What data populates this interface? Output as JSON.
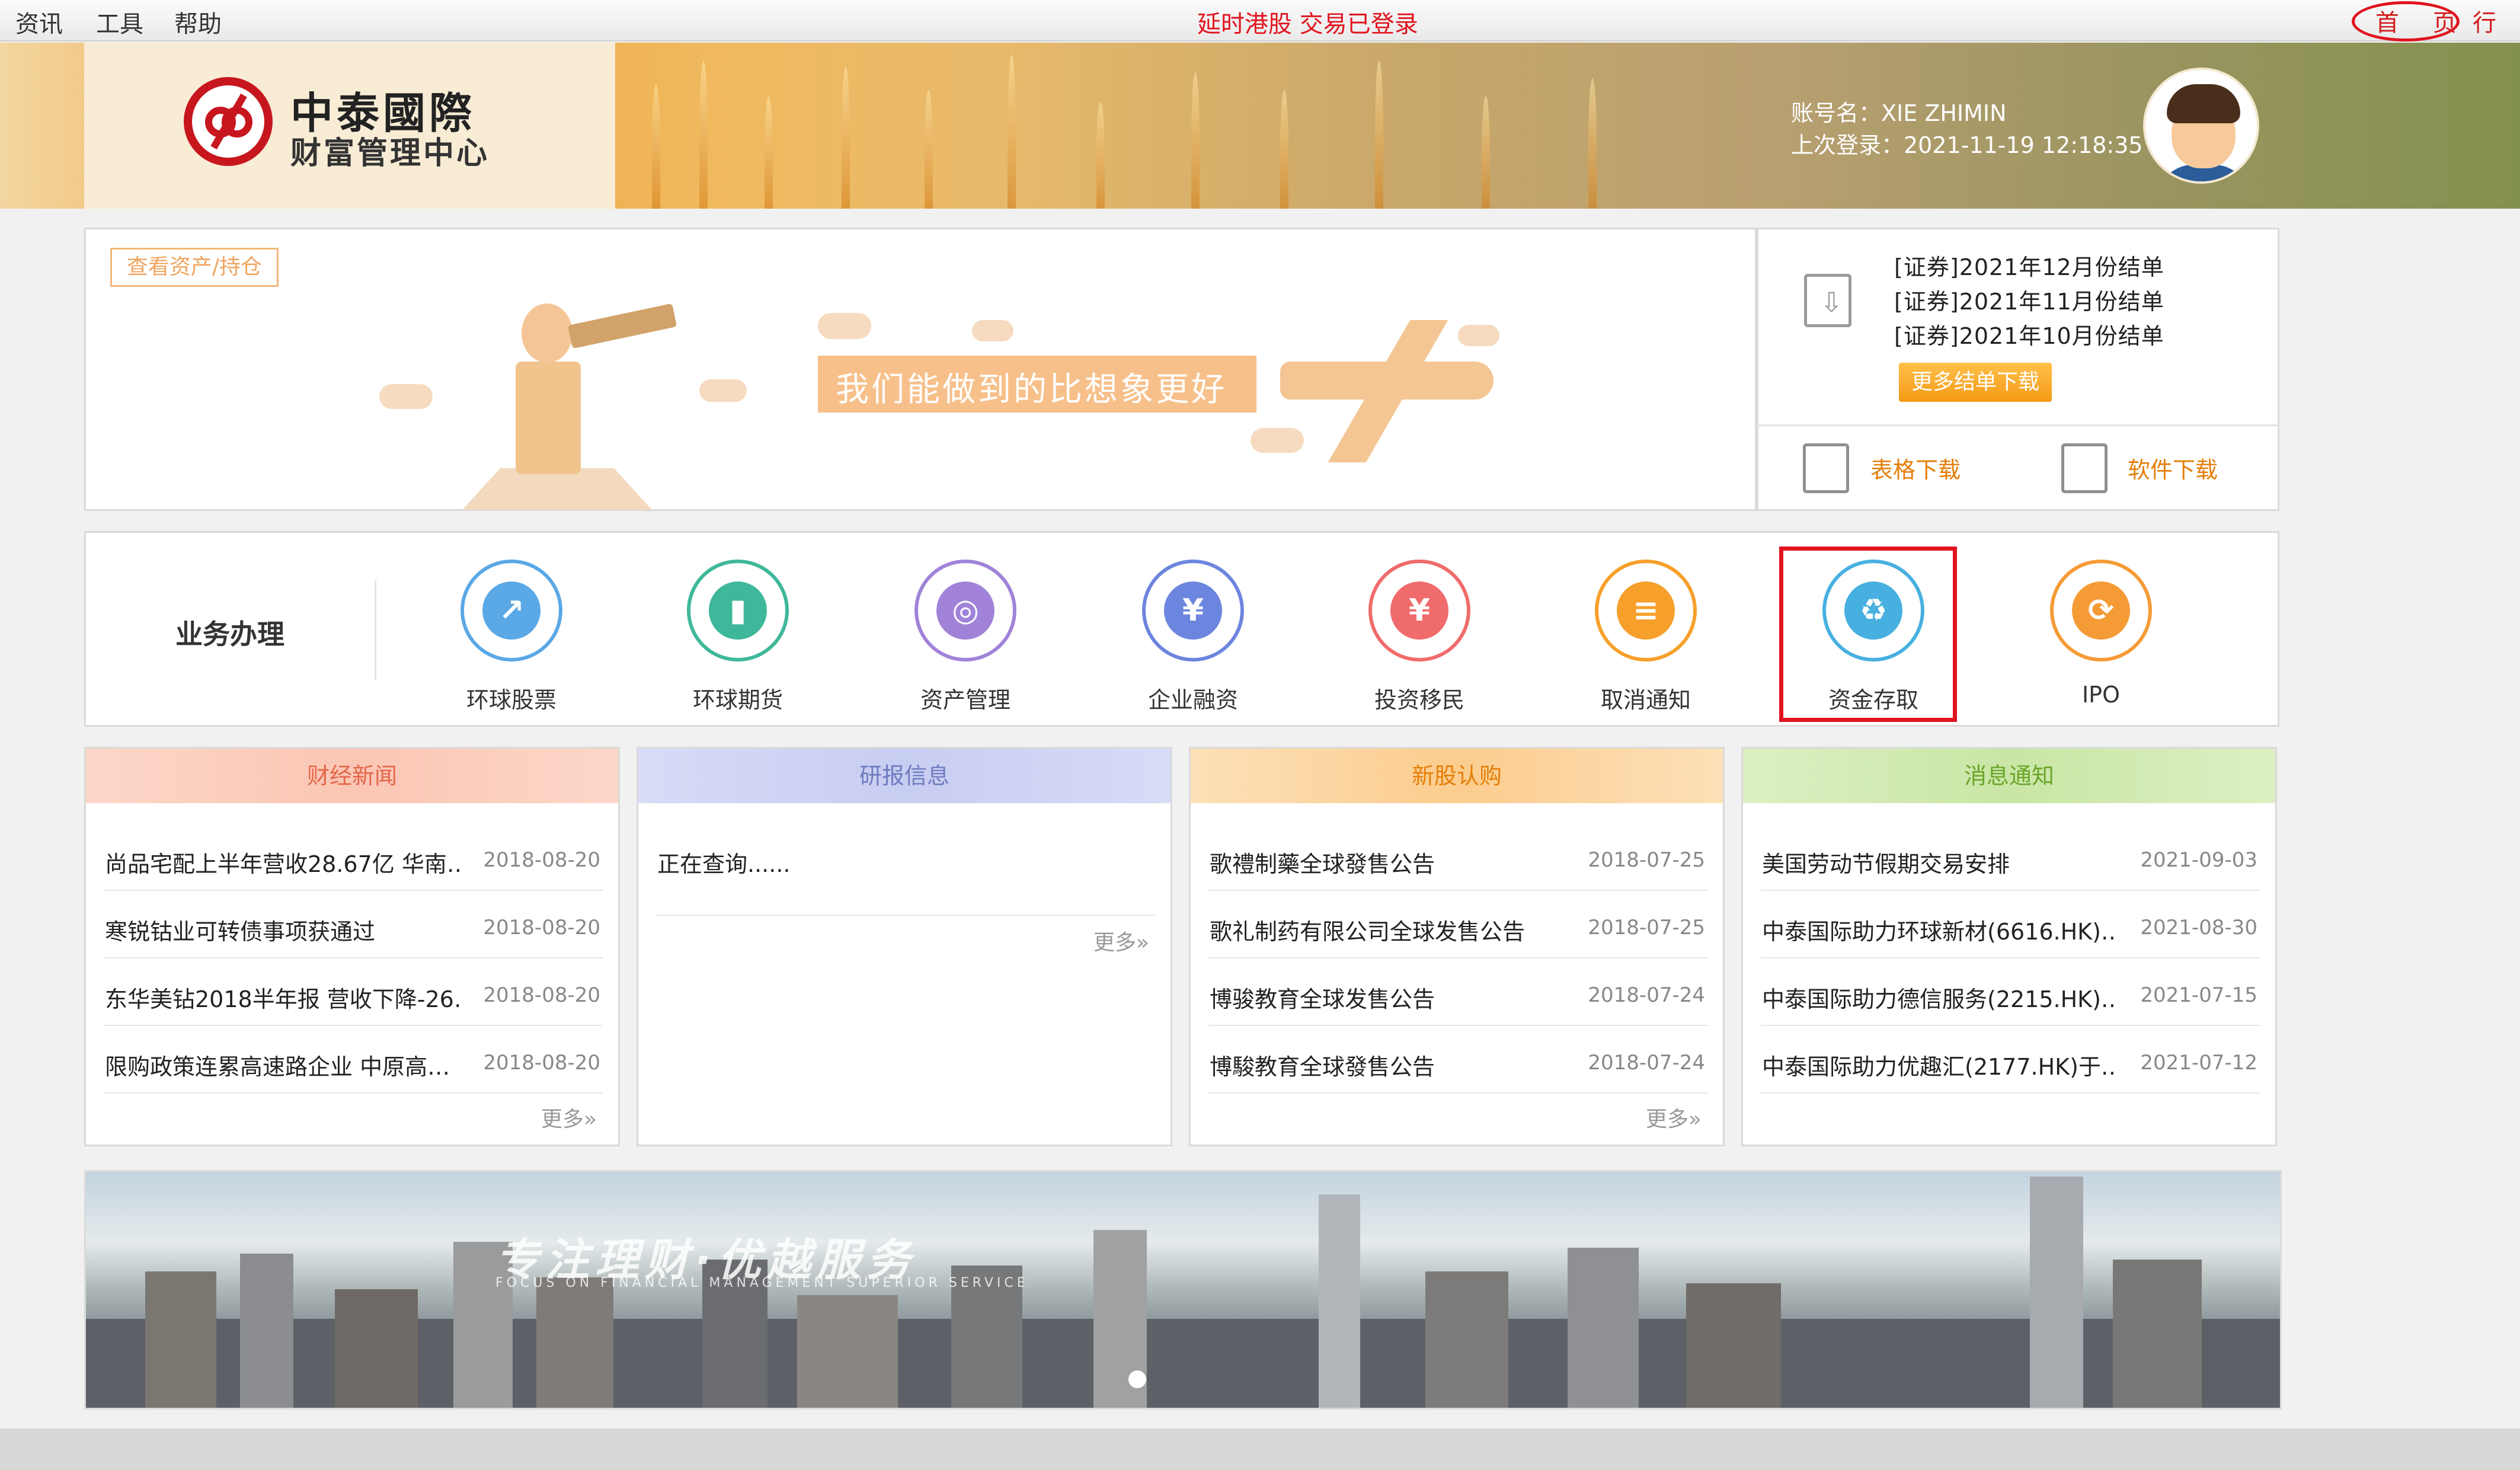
{
  "menubar": {
    "items": [
      "资讯",
      "工具",
      "帮助"
    ],
    "notice": "延时港股 交易已登录",
    "home": "首 页",
    "more": "行"
  },
  "header": {
    "logo_title": "中泰國際",
    "logo_sub": "财富管理中心",
    "account_name": "账号名：XIE ZHIMIN",
    "last_login": "上次登录：2021-11-19 12:18:35"
  },
  "promo": {
    "view_assets": "查看资产/持仓",
    "slogan": "我们能做到的比想象更好"
  },
  "statements": {
    "items": [
      "[证券]2021年12月份结单",
      "[证券]2021年11月份结单",
      "[证券]2021年10月份结单"
    ],
    "more_button": "更多结单下载",
    "form_download": "表格下载",
    "software_download": "软件下载"
  },
  "services": {
    "title": "业务办理",
    "items": [
      {
        "label": "环球股票",
        "icon": "stock-chart-icon",
        "color": "#5aa8e6"
      },
      {
        "label": "环球期货",
        "icon": "bar-chart-icon",
        "color": "#3fb79a"
      },
      {
        "label": "资产管理",
        "icon": "coins-icon",
        "color": "#a083d9"
      },
      {
        "label": "企业融资",
        "icon": "money-bag-icon",
        "color": "#6c85de"
      },
      {
        "label": "投资移民",
        "icon": "hand-money-icon",
        "color": "#f06b6b"
      },
      {
        "label": "取消通知",
        "icon": "document-icon",
        "color": "#f6a02b"
      },
      {
        "label": "资金存取",
        "icon": "globe-recycle-icon",
        "color": "#47b0e0"
      },
      {
        "label": "IPO",
        "icon": "refresh-icon",
        "color": "#f59b36"
      }
    ]
  },
  "cards": {
    "finance_news": {
      "title": "财经新闻",
      "rows": [
        {
          "title": "尚品宅配上半年营收28.67亿 华南…",
          "date": "2018-08-20"
        },
        {
          "title": "寒锐钴业可转债事项获通过",
          "date": "2018-08-20"
        },
        {
          "title": "东华美钻2018半年报 营收下降-26…",
          "date": "2018-08-20"
        },
        {
          "title": "限购政策连累高速路企业 中原高…",
          "date": "2018-08-20"
        }
      ],
      "more": "更多»"
    },
    "research": {
      "title": "研报信息",
      "loading": "正在查询......",
      "more": "更多»"
    },
    "ipo_sub": {
      "title": "新股认购",
      "rows": [
        {
          "title": "歌禮制藥全球發售公告",
          "date": "2018-07-25"
        },
        {
          "title": "歌礼制药有限公司全球发售公告",
          "date": "2018-07-25"
        },
        {
          "title": "博骏教育全球发售公告",
          "date": "2018-07-24"
        },
        {
          "title": "博駿教育全球發售公告",
          "date": "2018-07-24"
        }
      ],
      "more": "更多»"
    },
    "notices": {
      "title": "消息通知",
      "rows": [
        {
          "title": "美国劳动节假期交易安排",
          "date": "2021-09-03"
        },
        {
          "title": "中泰国际助力环球新材(6616.HK)…",
          "date": "2021-08-30"
        },
        {
          "title": "中泰国际助力德信服务(2215.HK)…",
          "date": "2021-07-15"
        },
        {
          "title": "中泰国际助力优趣汇(2177.HK)于…",
          "date": "2021-07-12"
        }
      ]
    }
  },
  "banner": {
    "slogan": "专注理财·优越服务",
    "sub": "FOCUS ON FINANCIAL MANAGEMENT SUPERIOR SERVICE"
  },
  "colors": {
    "accent_red": "#e0141e",
    "brand_red": "#c7161e",
    "orange": "#f59a16"
  }
}
